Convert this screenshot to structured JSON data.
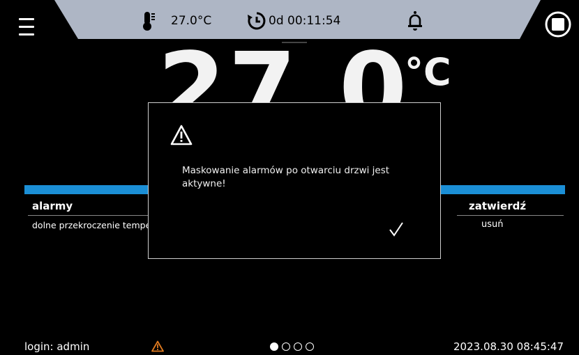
{
  "top_bar": {
    "temperature": "27.0°C",
    "timer": "0d 00:11:54"
  },
  "main_reading": {
    "value": "27.0",
    "unit": "°C"
  },
  "alarms_panel": {
    "header": "alarmy",
    "confirm_header": "zatwierdź",
    "rows": [
      {
        "text": "dolne przekroczenie tempe",
        "action": "usuń"
      }
    ]
  },
  "dialog": {
    "message": "Maskowanie alarmów po otwarciu drzwi jest aktywne!"
  },
  "footer": {
    "login": "login: admin",
    "datetime": "2023.08.30 08:45:47",
    "pagination": {
      "total": 4,
      "current": 1
    }
  },
  "colors": {
    "top_band": "#aeb6c5",
    "accent_blue": "#1b8fd6",
    "warning_orange": "#e07a1f"
  },
  "icons": {
    "menu": "hamburger-menu-icon",
    "temperature": "thermometer-icon",
    "timer": "clock-icon",
    "bell": "bell-icon",
    "stop": "stop-icon",
    "dialog_warning": "warning-icon",
    "confirm": "checkmark-icon",
    "footer_warning": "warning-icon"
  }
}
